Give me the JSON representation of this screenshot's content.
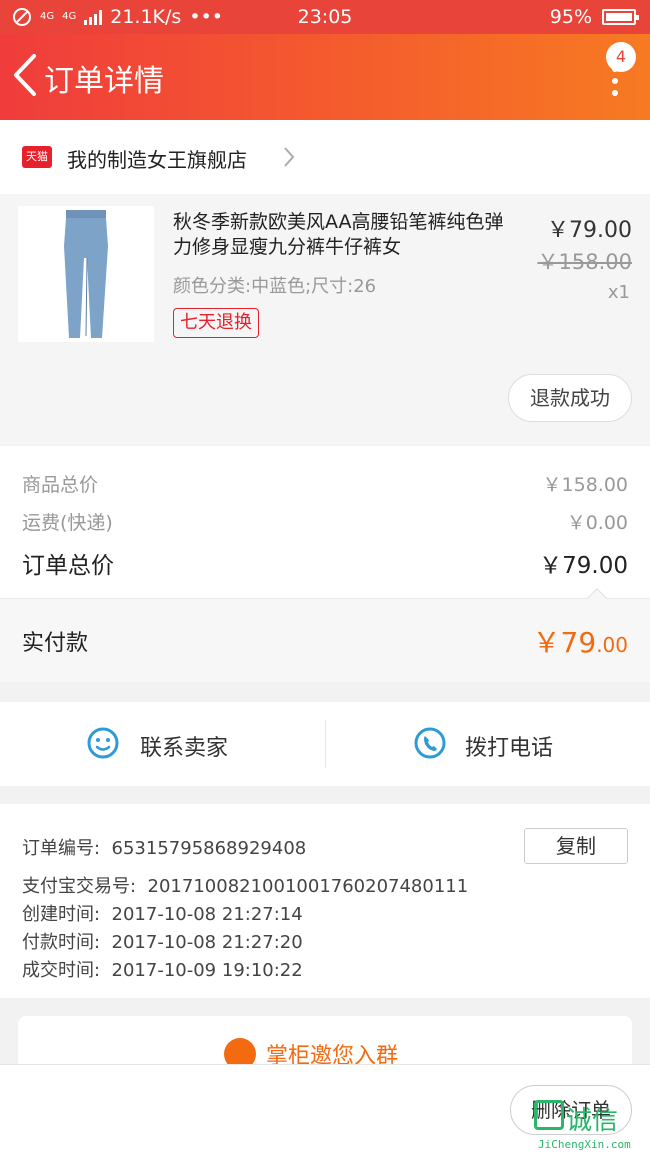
{
  "status_bar": {
    "network": "4G",
    "network_small": "4G",
    "speed": "21.1K/s",
    "dots": "•••",
    "time": "23:05",
    "battery": "95%"
  },
  "nav": {
    "title": "订单详情",
    "badge": "4",
    "back_icon": "chevron-left-icon",
    "more_icon": "more-vertical-icon"
  },
  "store": {
    "badge": "天猫",
    "name": "我的制造女王旗舰店"
  },
  "product": {
    "title": "秋冬季新款欧美风AA高腰铅笔裤纯色弹力修身显瘦九分裤牛仔裤女",
    "price": "￥79.00",
    "original_price": "￥158.00",
    "quantity": "x1",
    "sku": "颜色分类:中蓝色;尺寸:26",
    "tag": "七天退换",
    "refund_status": "退款成功"
  },
  "price_summary": {
    "goods_total_label": "商品总价",
    "goods_total_value": "￥158.00",
    "shipping_label": "运费(快递)",
    "shipping_value": "￥0.00",
    "order_total_label": "订单总价",
    "order_total_value": "￥79.00"
  },
  "paid": {
    "label": "实付款",
    "value_big": "￥79",
    "value_small": ".00"
  },
  "contact": {
    "seller_label": "联系卖家",
    "phone_label": "拨打电话"
  },
  "order_info": {
    "order_no_label": "订单编号:",
    "order_no": "65315795868929408",
    "copy_label": "复制",
    "alipay_label": "支付宝交易号:",
    "alipay_no": "2017100821001001760207480111",
    "created_label": "创建时间:",
    "created": "2017-10-08 21:27:14",
    "paid_label": "付款时间:",
    "paid": "2017-10-08 21:27:20",
    "deal_label": "成交时间:",
    "deal": "2017-10-09 19:10:22"
  },
  "group": {
    "label": "掌柜邀您入群"
  },
  "bottom": {
    "delete_label": "删除订单"
  },
  "watermark": {
    "text": "诚信",
    "sub": "JiChengXin.com"
  },
  "colors": {
    "accent": "#e8443a",
    "price_orange": "#f36a10",
    "icon_blue": "#2f9bd6"
  }
}
